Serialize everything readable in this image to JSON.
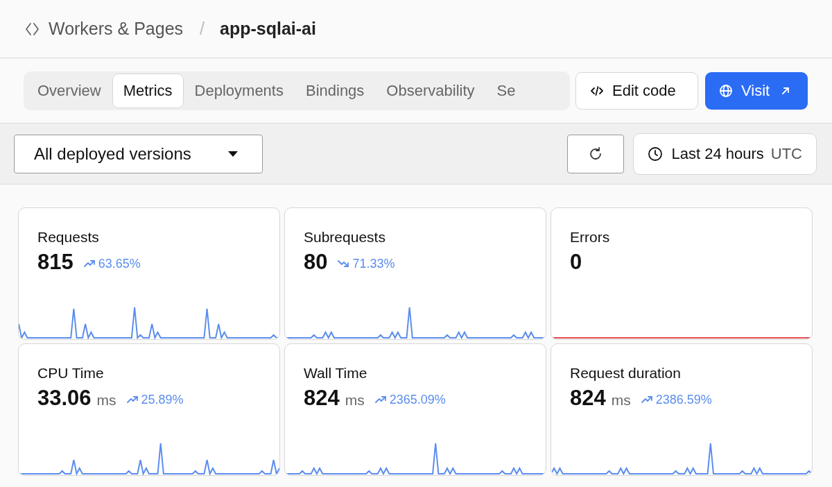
{
  "breadcrumb": {
    "parent": "Workers & Pages",
    "separator": "/",
    "current": "app-sqlai-ai"
  },
  "tabs": [
    {
      "label": "Overview",
      "selected": false
    },
    {
      "label": "Metrics",
      "selected": true
    },
    {
      "label": "Deployments",
      "selected": false
    },
    {
      "label": "Bindings",
      "selected": false
    },
    {
      "label": "Observability",
      "selected": false
    },
    {
      "label": "Se",
      "selected": false
    }
  ],
  "actions": {
    "edit_code": "Edit code",
    "visit": "Visit"
  },
  "toolbar": {
    "versions": "All deployed versions",
    "time_range": "Last 24 hours",
    "timezone": "UTC"
  },
  "metrics": [
    {
      "title": "Requests",
      "value": "815",
      "change": "63.65%",
      "kind": "up",
      "color": "#5b8def"
    },
    {
      "title": "Subrequests",
      "value": "80",
      "change": "71.33%",
      "kind": "down",
      "color": "#5b8def"
    },
    {
      "title": "Errors",
      "value": "0",
      "color": "#e5484d"
    },
    {
      "title": "CPU Time",
      "value": "33.06",
      "unit": "ms",
      "change": "25.89%",
      "kind": "up",
      "color": "#5b8def"
    },
    {
      "title": "Wall Time",
      "value": "824",
      "unit": "ms",
      "change": "2365.09%",
      "kind": "up",
      "color": "#5b8def"
    },
    {
      "title": "Request duration",
      "value": "824",
      "unit": "ms",
      "change": "2386.59%",
      "kind": "up",
      "color": "#5b8def"
    }
  ]
}
